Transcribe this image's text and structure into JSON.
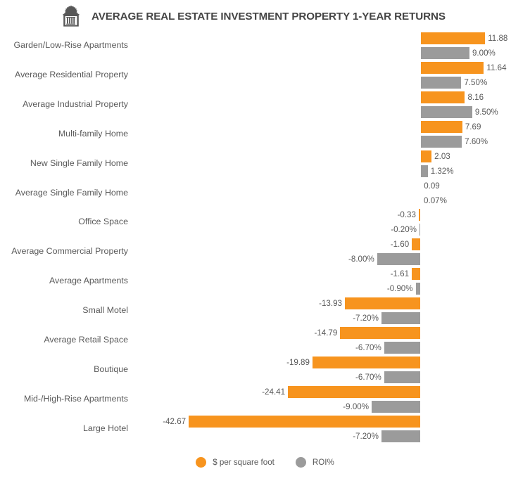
{
  "header": {
    "title": "AVERAGE REAL ESTATE INVESTMENT PROPERTY 1-YEAR RETURNS",
    "icon": "bank-building-icon"
  },
  "legend": {
    "items": [
      {
        "label": "$ per square foot",
        "color": "#F7941E",
        "marker": "circle-marker-orange"
      },
      {
        "label": "ROI%",
        "color": "#9B9B9B",
        "marker": "circle-marker-gray"
      }
    ]
  },
  "colors": {
    "series_dollar": "#F7941E",
    "series_roi": "#9B9B9B",
    "text": "#595959",
    "title": "#444444",
    "background": "#FFFFFF"
  },
  "chart_data": {
    "type": "bar",
    "orientation": "horizontal",
    "title": "AVERAGE REAL ESTATE INVESTMENT PROPERTY 1-YEAR RETURNS",
    "xlabel": "",
    "ylabel": "",
    "grid": false,
    "legend_position": "bottom",
    "axis_zero": 0,
    "xlim": [
      -45,
      15
    ],
    "categories": [
      "Garden/Low-Rise Apartments",
      "Average Residential Property",
      "Average Industrial Property",
      "Multi-family Home",
      "New Single Family Home",
      "Average Single Family Home",
      "Office Space",
      "Average Commercial Property",
      "Average Apartments",
      "Small Motel",
      "Average Retail Space",
      "Boutique",
      "Mid-/High-Rise Apartments",
      "Large Hotel"
    ],
    "series": [
      {
        "name": "$ per square foot",
        "color": "#F7941E",
        "values": [
          11.88,
          11.64,
          8.16,
          7.69,
          2.03,
          0.09,
          -0.33,
          -1.6,
          -1.61,
          -13.93,
          -14.79,
          -19.89,
          -24.41,
          -42.67
        ],
        "labels": [
          "11.88",
          "11.64",
          "8.16",
          "7.69",
          "2.03",
          "0.09",
          "-0.33",
          "-1.60",
          "-1.61",
          "-13.93",
          "-14.79",
          "-19.89",
          "-24.41",
          "-42.67"
        ]
      },
      {
        "name": "ROI%",
        "color": "#9B9B9B",
        "values": [
          9.0,
          7.5,
          9.5,
          7.6,
          1.32,
          0.07,
          -0.2,
          -8.0,
          -0.9,
          -7.2,
          -6.7,
          -6.7,
          -9.0,
          -7.2
        ],
        "labels": [
          "9.00%",
          "7.50%",
          "9.50%",
          "7.60%",
          "1.32%",
          "0.07%",
          "-0.20%",
          "-8.00%",
          "-0.90%",
          "-7.20%",
          "-6.70%",
          "-6.70%",
          "-9.00%",
          "-7.20%"
        ]
      }
    ]
  }
}
